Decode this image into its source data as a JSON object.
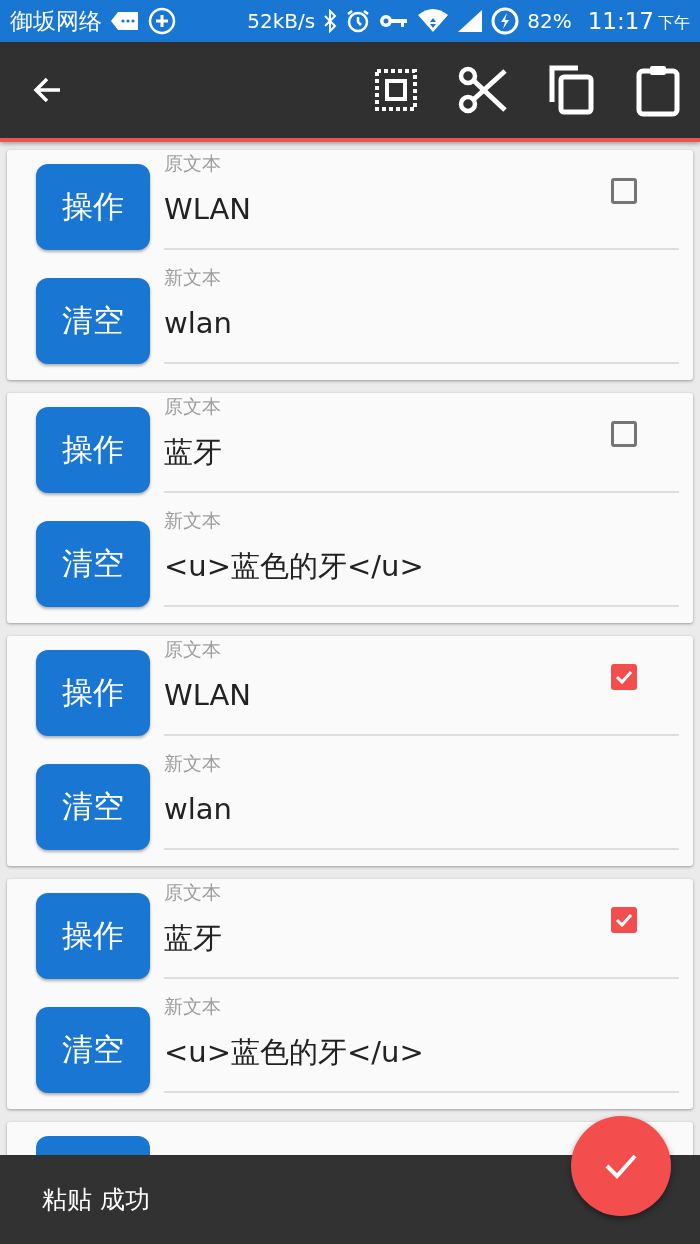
{
  "status_bar": {
    "carrier": "御坂网络",
    "speed": "52kB/s",
    "battery": "82%",
    "time": "11:17",
    "period": "下午"
  },
  "entries": [
    {
      "action_button": "操作",
      "original_label": "原文本",
      "original": "WLAN",
      "checked": false,
      "clear_button": "清空",
      "new_label": "新文本",
      "new": "wlan"
    },
    {
      "action_button": "操作",
      "original_label": "原文本",
      "original": "蓝牙",
      "checked": false,
      "clear_button": "清空",
      "new_label": "新文本",
      "new": "<u>蓝色的牙</u>"
    },
    {
      "action_button": "操作",
      "original_label": "原文本",
      "original": "WLAN",
      "checked": true,
      "clear_button": "清空",
      "new_label": "新文本",
      "new": "wlan"
    },
    {
      "action_button": "操作",
      "original_label": "原文本",
      "original": "蓝牙",
      "checked": true,
      "clear_button": "清空",
      "new_label": "新文本",
      "new": "<u>蓝色的牙</u>"
    }
  ],
  "snackbar": {
    "message": "粘贴 成功"
  }
}
